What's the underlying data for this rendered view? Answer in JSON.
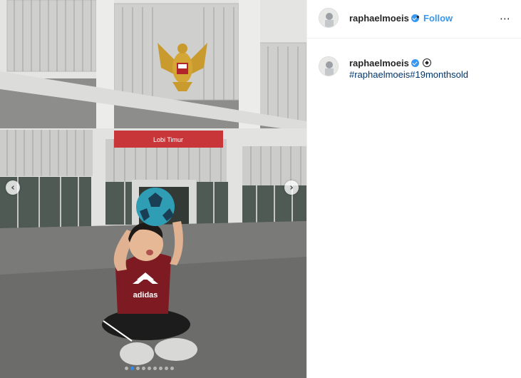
{
  "photo": {
    "building_sign": "Lobi Timur",
    "shirt_text": "adidas",
    "carousel": {
      "total_slides": 9,
      "active_slide": 2
    }
  },
  "header": {
    "username": "raphaelmoeis",
    "separator": "•",
    "follow_label": "Follow",
    "more_icon": "⋯"
  },
  "caption": {
    "username": "raphaelmoeis",
    "hashtags": "#raphaelmoeis#19monthsold"
  },
  "colors": {
    "accent": "#3897f0",
    "hashtag": "#003569",
    "text": "#262626"
  },
  "icons": [
    "chevron-left-icon",
    "chevron-right-icon",
    "verified-badge-icon",
    "soccer-ball-icon",
    "more-options-icon"
  ]
}
